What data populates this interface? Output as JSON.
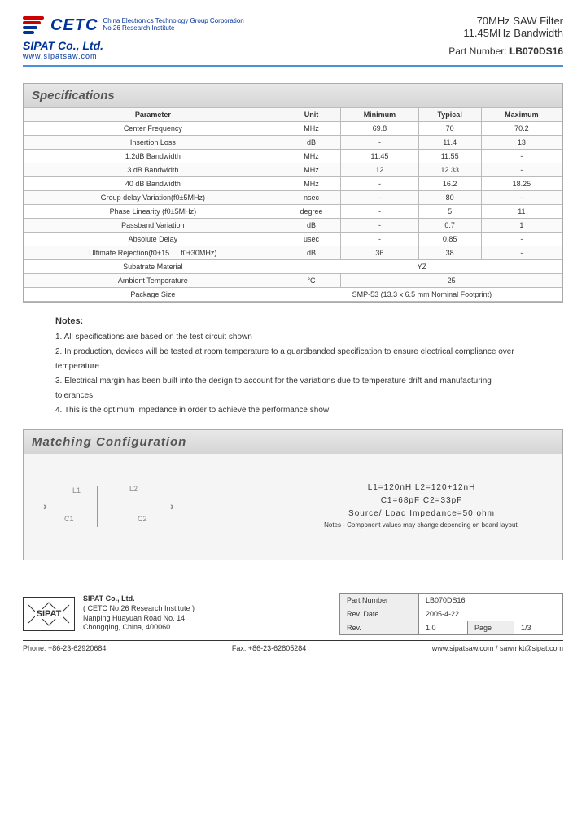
{
  "header": {
    "cetc": "CETC",
    "cetc_sub1": "China Electronics Technology Group Corporation",
    "cetc_sub2": "No.26 Research Institute",
    "sipat": "SIPAT Co., Ltd.",
    "website": "www.sipatsaw.com",
    "title1": "70MHz SAW Filter",
    "title2": "11.45MHz Bandwidth",
    "part_label": "Part Number:",
    "part_value": "LB070DS16"
  },
  "specs": {
    "title": "Specifications",
    "headers": [
      "Parameter",
      "Unit",
      "Minimum",
      "Typical",
      "Maximum"
    ],
    "rows": [
      [
        "Center Frequency",
        "MHz",
        "69.8",
        "70",
        "70.2"
      ],
      [
        "Insertion Loss",
        "dB",
        "-",
        "11.4",
        "13"
      ],
      [
        "1.2dB Bandwidth",
        "MHz",
        "11.45",
        "11.55",
        "-"
      ],
      [
        "3 dB Bandwidth",
        "MHz",
        "12",
        "12.33",
        "-"
      ],
      [
        "40 dB Bandwidth",
        "MHz",
        "-",
        "16.2",
        "18.25"
      ],
      [
        "Group delay Variation(f0±5MHz)",
        "nsec",
        "-",
        "80",
        "-"
      ],
      [
        "Phase Linearity (f0±5MHz)",
        "degree",
        "-",
        "5",
        "11"
      ],
      [
        "Passband Variation",
        "dB",
        "-",
        "0.7",
        "1"
      ],
      [
        "Absolute Delay",
        "usec",
        "-",
        "0.85",
        "-"
      ],
      [
        "Ultimate Rejection(f0+15 … f0+30MHz)",
        "dB",
        "36",
        "38",
        "-"
      ]
    ],
    "substrate_label": "Subatrate Material",
    "substrate_value": "YZ",
    "ambient_label": "Ambient Temperature",
    "ambient_unit": "°C",
    "ambient_value": "25",
    "package_label": "Package Size",
    "package_value": "SMP-53   (13.3 x 6.5 mm Nominal Footprint)"
  },
  "notes": {
    "title": "Notes:",
    "items": [
      "1. All specifications are based on the test circuit shown",
      "2. In production, devices will be tested at room temperature to a guardbanded specification to ensure electrical compliance over temperature",
      "3. Electrical margin has been built into the design to account for the variations due to temperature drift and manufacturing tolerances",
      "4. This is the optimum impedance in order to achieve the performance show"
    ]
  },
  "matching": {
    "title": "Matching Configuration",
    "labels": {
      "l1": "L1",
      "l2": "L2",
      "c1": "C1",
      "c2": "C2"
    },
    "line1": "L1=120nH   L2=120+12nH",
    "line2": "C1=68pF   C2=33pF",
    "line3": "Source/ Load Impedance=50 ohm",
    "note": "Notes - Component values may change depending on board layout."
  },
  "footer": {
    "sipat_logo": "SIPAT",
    "company": "SIPAT Co., Ltd.",
    "inst": "( CETC No.26 Research Institute )",
    "addr1": "Nanping Huayuan Road No. 14",
    "addr2": "Chongqing, China, 400060",
    "part_label": "Part Number",
    "part_value": "LB070DS16",
    "date_label": "Rev. Date",
    "date_value": "2005-4-22",
    "rev_label": "Rev.",
    "rev_value": "1.0",
    "page_label": "Page",
    "page_value": "1/3",
    "phone": "Phone: +86-23-62920684",
    "fax": "Fax: +86-23-62805284",
    "contact": "www.sipatsaw.com / sawmkt@sipat.com"
  }
}
